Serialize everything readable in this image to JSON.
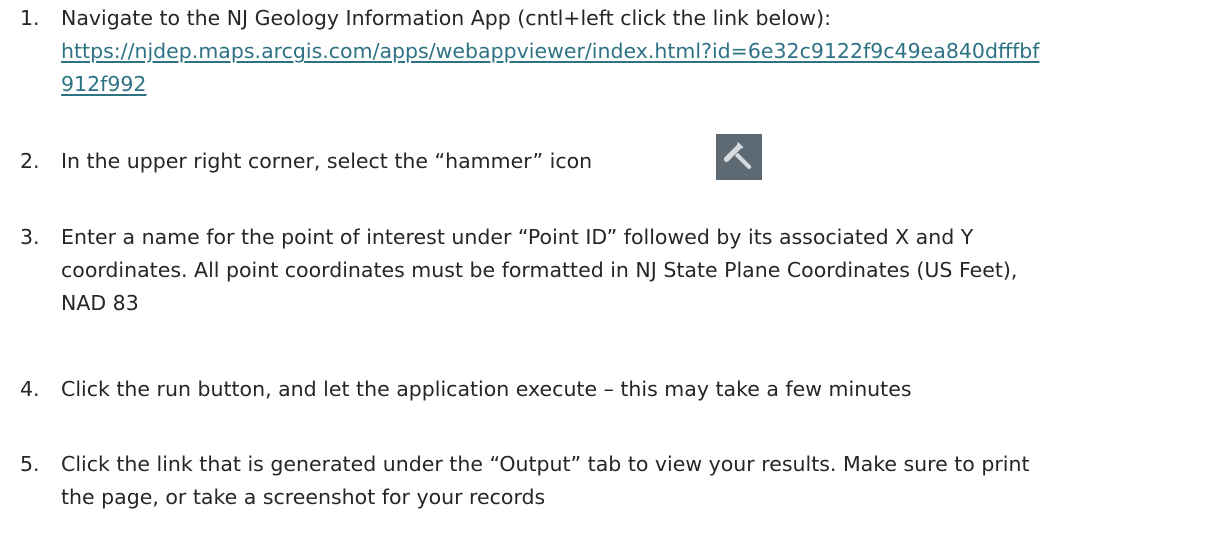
{
  "steps": [
    {
      "number": "1.",
      "lines": [
        "Navigate to the NJ Geology Information App (cntl+left click the link below):"
      ],
      "link_lines": [
        "https://njdep.maps.arcgis.com/apps/webappviewer/index.html?id=6e32c9122f9c49ea840dfffbf",
        "912f992"
      ]
    },
    {
      "number": "2.",
      "lines": [
        "In the upper right corner, select the “hammer” icon"
      ],
      "icon": "hammer-icon"
    },
    {
      "number": "3.",
      "lines": [
        "Enter a name for the point of interest under “Point ID” followed by its associated X and Y",
        "coordinates. All point coordinates must be formatted in NJ State Plane Coordinates (US Feet),",
        "NAD 83"
      ]
    },
    {
      "number": "4.",
      "lines": [
        "Click the run button, and let the application execute – this may take a few minutes"
      ]
    },
    {
      "number": "5.",
      "lines": [
        "Click the link that is generated under the “Output” tab to view your results. Make sure to print",
        "the page, or take a screenshot for your records"
      ]
    }
  ],
  "colors": {
    "text": "#262626",
    "link": "#2e7384",
    "icon_bg": "#5d6a73",
    "icon_fg": "#d7dbde"
  }
}
